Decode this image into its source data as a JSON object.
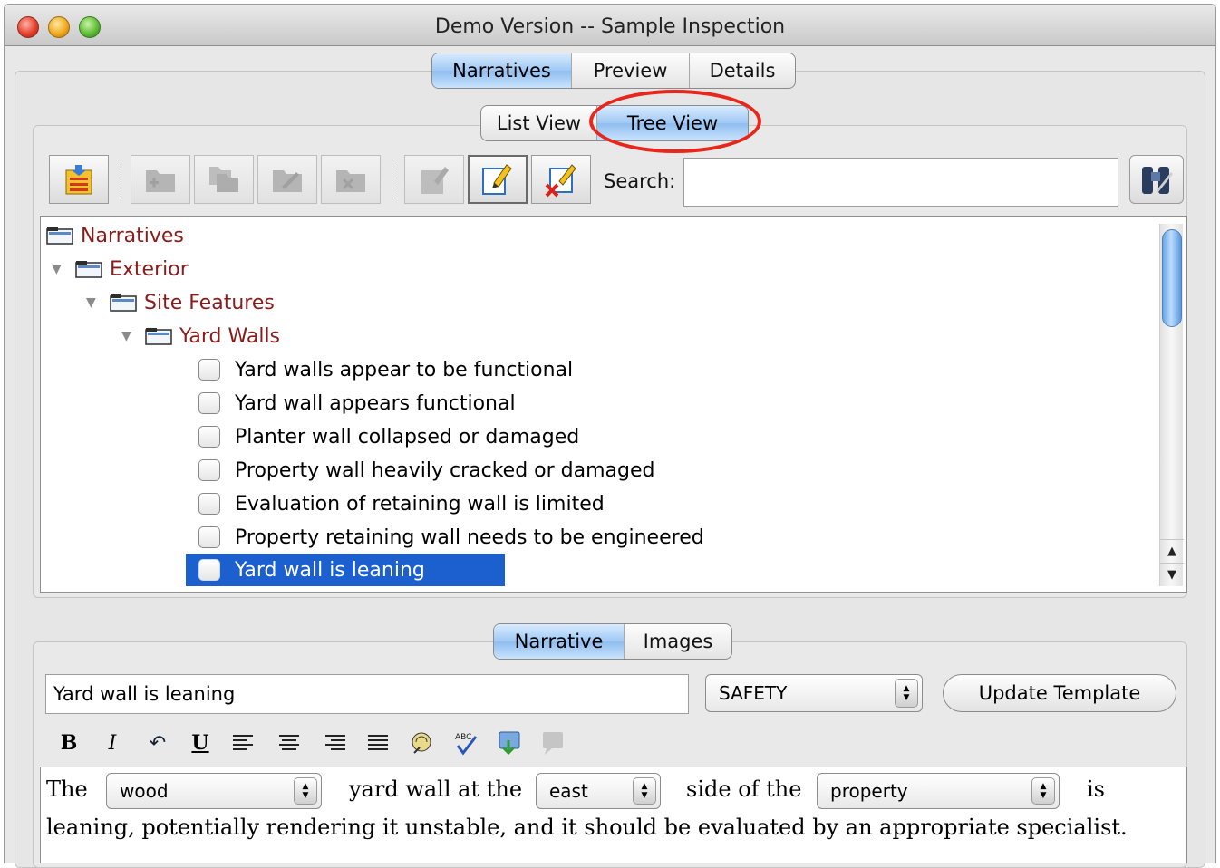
{
  "window": {
    "title": "Demo Version -- Sample Inspection"
  },
  "main_tabs": [
    {
      "label": "Narratives",
      "active": true
    },
    {
      "label": "Preview",
      "active": false
    },
    {
      "label": "Details",
      "active": false
    }
  ],
  "view_tabs": [
    {
      "label": "List View",
      "active": false
    },
    {
      "label": "Tree View",
      "active": true
    }
  ],
  "toolbar": {
    "buttons": [
      {
        "name": "import-folder-icon",
        "enabled": true
      },
      {
        "name": "add-folder-icon",
        "enabled": false
      },
      {
        "name": "copy-folder-icon",
        "enabled": false
      },
      {
        "name": "rename-folder-icon",
        "enabled": false
      },
      {
        "name": "delete-folder-icon",
        "enabled": false
      },
      {
        "name": "add-narrative-icon",
        "enabled": false
      },
      {
        "name": "edit-narrative-icon",
        "enabled": true
      },
      {
        "name": "delete-narrative-icon",
        "enabled": true
      },
      {
        "name": "binoculars-icon",
        "enabled": true
      }
    ],
    "search_label": "Search:",
    "search_value": ""
  },
  "tree": {
    "items": [
      {
        "type": "folder",
        "label": "Narratives",
        "level": 0,
        "expanded": false
      },
      {
        "type": "folder",
        "label": "Exterior",
        "level": 1,
        "expanded": true
      },
      {
        "type": "folder",
        "label": "Site Features",
        "level": 2,
        "expanded": true
      },
      {
        "type": "folder",
        "label": "Yard Walls",
        "level": 3,
        "expanded": true
      },
      {
        "type": "check",
        "label": "Yard walls appear to be functional",
        "checked": false
      },
      {
        "type": "check",
        "label": "Yard wall appears functional",
        "checked": false
      },
      {
        "type": "check",
        "label": "Planter wall collapsed or damaged",
        "checked": false
      },
      {
        "type": "check",
        "label": "Property wall heavily cracked or damaged",
        "checked": false
      },
      {
        "type": "check",
        "label": "Evaluation of retaining wall is limited",
        "checked": false
      },
      {
        "type": "check",
        "label": "Property retaining wall needs to be engineered",
        "checked": false
      },
      {
        "type": "check",
        "label": "Yard wall is leaning",
        "checked": false,
        "selected": true
      }
    ]
  },
  "detail_tabs": [
    {
      "label": "Narrative",
      "active": true
    },
    {
      "label": "Images",
      "active": false
    }
  ],
  "detail": {
    "title_value": "Yard wall is leaning",
    "category": "SAFETY",
    "update_button": "Update Template"
  },
  "format_bar": {
    "bold": "B",
    "italic": "I",
    "undo": "↶",
    "underline": "U"
  },
  "editor": {
    "w1": "The",
    "dropdown1": "wood",
    "w2": "yard wall at the",
    "dropdown2": "east",
    "w3": "side of the",
    "dropdown3": "property",
    "w4": "is",
    "line2": "leaning, potentially rendering it unstable, and it should be evaluated by an appropriate specialist."
  },
  "colors": {
    "folder_text": "#8b1a1a",
    "selection": "#1c5fcf",
    "annotation": "#e8261a",
    "active_tab": "#9ec8f4"
  }
}
